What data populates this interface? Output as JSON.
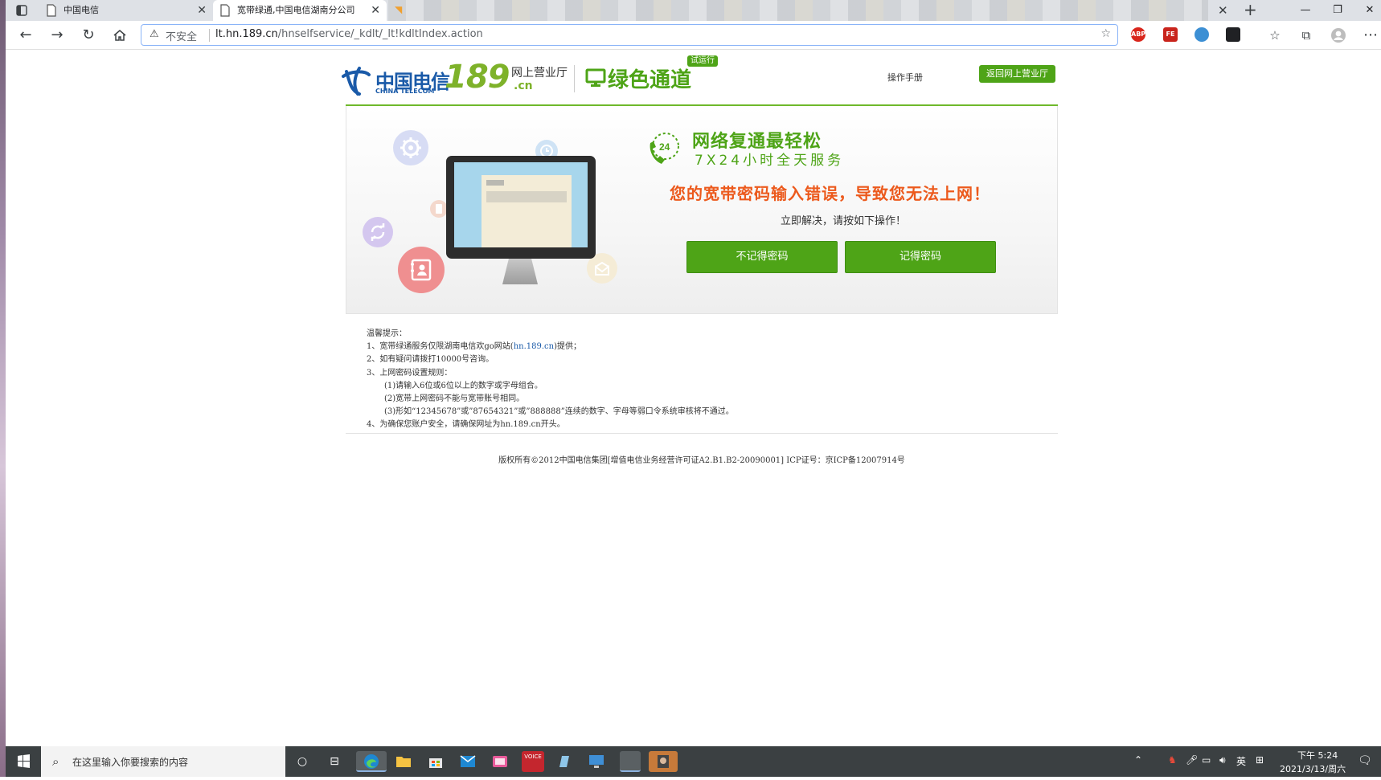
{
  "browser": {
    "tabs": [
      {
        "title": "中国电信"
      },
      {
        "title": "宽带绿通,中国电信湖南分公司"
      }
    ],
    "address": {
      "security_label": "不安全",
      "url_host": "lt.hn.189.cn",
      "url_path": "/hnselfservice/_kdlt/_lt!kdltIndex.action"
    },
    "extensions": [
      "ABP",
      "FE"
    ]
  },
  "header": {
    "logo_cn": "中国电信",
    "logo_en": "CHINA TELECOM",
    "logo_number": "189",
    "logo_hall": "网上营业厅",
    "logo_domain": ".cn",
    "channel_title": "绿色通道",
    "trial_badge": "试运行",
    "manual_link": "操作手册",
    "back_button": "返回网上营业厅"
  },
  "banner": {
    "badge_24": "24",
    "slogan": "网络复通最轻松",
    "slogan_sub": "7X24小时全天服务",
    "error_message": "您的宽带密码输入错误，导致您无法上网！",
    "hint": "立即解决，请按如下操作！",
    "buttons": {
      "forgot": "不记得密码",
      "remember": "记得密码"
    }
  },
  "tips": {
    "title": "温馨提示：",
    "line1_prefix": "1、宽带绿通服务仅限湖南电信欢go网站(",
    "line1_link": "hn.189.cn",
    "line1_suffix": ")提供；",
    "line2": "2、如有疑问请拨打10000号咨询。",
    "line3": "3、上网密码设置规则：",
    "rule1": "(1)请输入6位或6位以上的数字或字母组合。",
    "rule2": "(2)宽带上网密码不能与宽带账号相同。",
    "rule3": "(3)形如“12345678”或”87654321”或”888888”连续的数字、字母等弱口令系统审核将不通过。",
    "line4": "4、为确保您账户安全，请确保网址为hn.189.cn开头。"
  },
  "footer": {
    "copyright": "版权所有©2012中国电信集团[增值电信业务经营许可证A2.B1.B2-20090001] ICP证号：京ICP备12007914号"
  },
  "taskbar": {
    "search_placeholder": "在这里输入你要搜索的内容",
    "voice_tile": "VOICE",
    "tray_lang": "英",
    "clock_time": "下午 5:24",
    "clock_date": "2021/3/13/周六"
  },
  "colors": {
    "brand_green": "#4ea417",
    "telecom_blue": "#1a5aa8",
    "error_orange": "#ec5a1d"
  }
}
